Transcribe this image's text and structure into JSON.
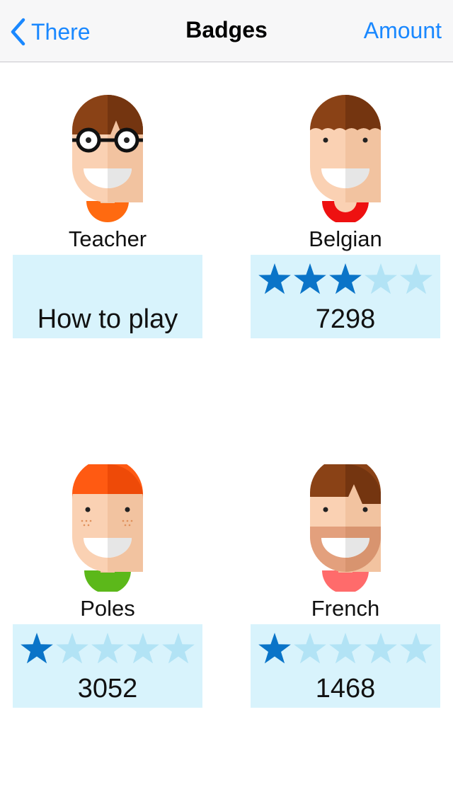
{
  "nav": {
    "back_label": "There",
    "title": "Badges",
    "right_label": "Amount"
  },
  "colors": {
    "accent": "#1a88ff",
    "card_bg": "#d8f3fc",
    "star_filled": "#0a74c8",
    "star_empty": "#b2e3f5"
  },
  "badges": [
    {
      "name": "Teacher",
      "info_text": "How to play",
      "hair": "#8a4216",
      "shirt": "#ff6a10",
      "accessory": "glasses-icon"
    },
    {
      "name": "Belgian",
      "score": "7298",
      "stars_filled": 3,
      "stars_total": 5,
      "hair": "#8a4216",
      "shirt": "#ee1111"
    },
    {
      "name": "Poles",
      "score": "3052",
      "stars_filled": 1,
      "stars_total": 5,
      "hair": "#ff5a12",
      "shirt": "#5cb81a",
      "accessory": "freckles"
    },
    {
      "name": "French",
      "score": "1468",
      "stars_filled": 1,
      "stars_total": 5,
      "hair": "#8a4216",
      "shirt": "#ff6b6b",
      "accessory": "beard"
    }
  ]
}
